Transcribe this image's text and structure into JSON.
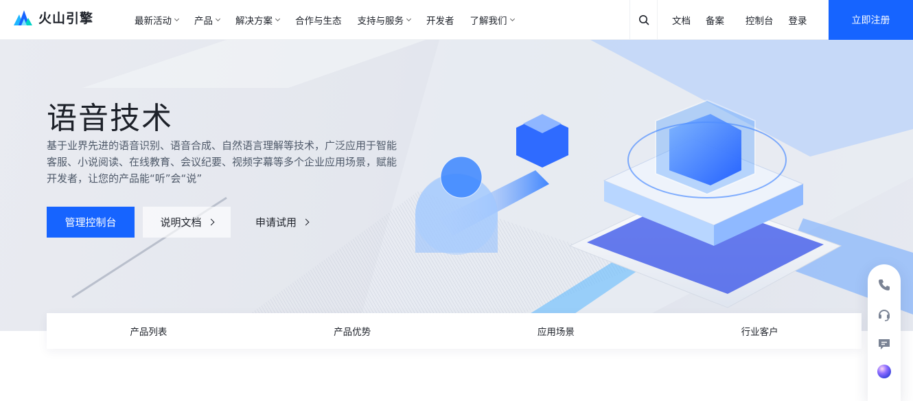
{
  "brand": {
    "name": "火山引擎"
  },
  "nav": {
    "menu": [
      {
        "label": "最新活动",
        "has_dropdown": true
      },
      {
        "label": "产品",
        "has_dropdown": true
      },
      {
        "label": "解决方案",
        "has_dropdown": true
      },
      {
        "label": "合作与生态",
        "has_dropdown": false
      },
      {
        "label": "支持与服务",
        "has_dropdown": true
      },
      {
        "label": "开发者",
        "has_dropdown": false
      },
      {
        "label": "了解我们",
        "has_dropdown": true
      }
    ],
    "right_links": {
      "docs": "文档",
      "filing": "备案",
      "console": "控制台",
      "login": "登录"
    },
    "register": "立即注册"
  },
  "hero": {
    "title": "语音技术",
    "description": "基于业界先进的语音识别、语音合成、自然语言理解等技术，广泛应用于智能客服、小说阅读、在线教育、会议纪要、视频字幕等多个企业应用场景，赋能开发者，让您的产品能“听”会“说”",
    "primary_button": "管理控制台",
    "secondary_button": "说明文档",
    "text_button": "申请试用"
  },
  "tabs": [
    "产品列表",
    "产品优势",
    "应用场景",
    "行业客户"
  ],
  "float_bar": {
    "icons": [
      "phone-icon",
      "headset-icon",
      "chat-icon",
      "assistant-orb-icon"
    ]
  },
  "colors": {
    "accent": "#1664ff",
    "text": "#1d2129",
    "muted": "#4e5969"
  }
}
